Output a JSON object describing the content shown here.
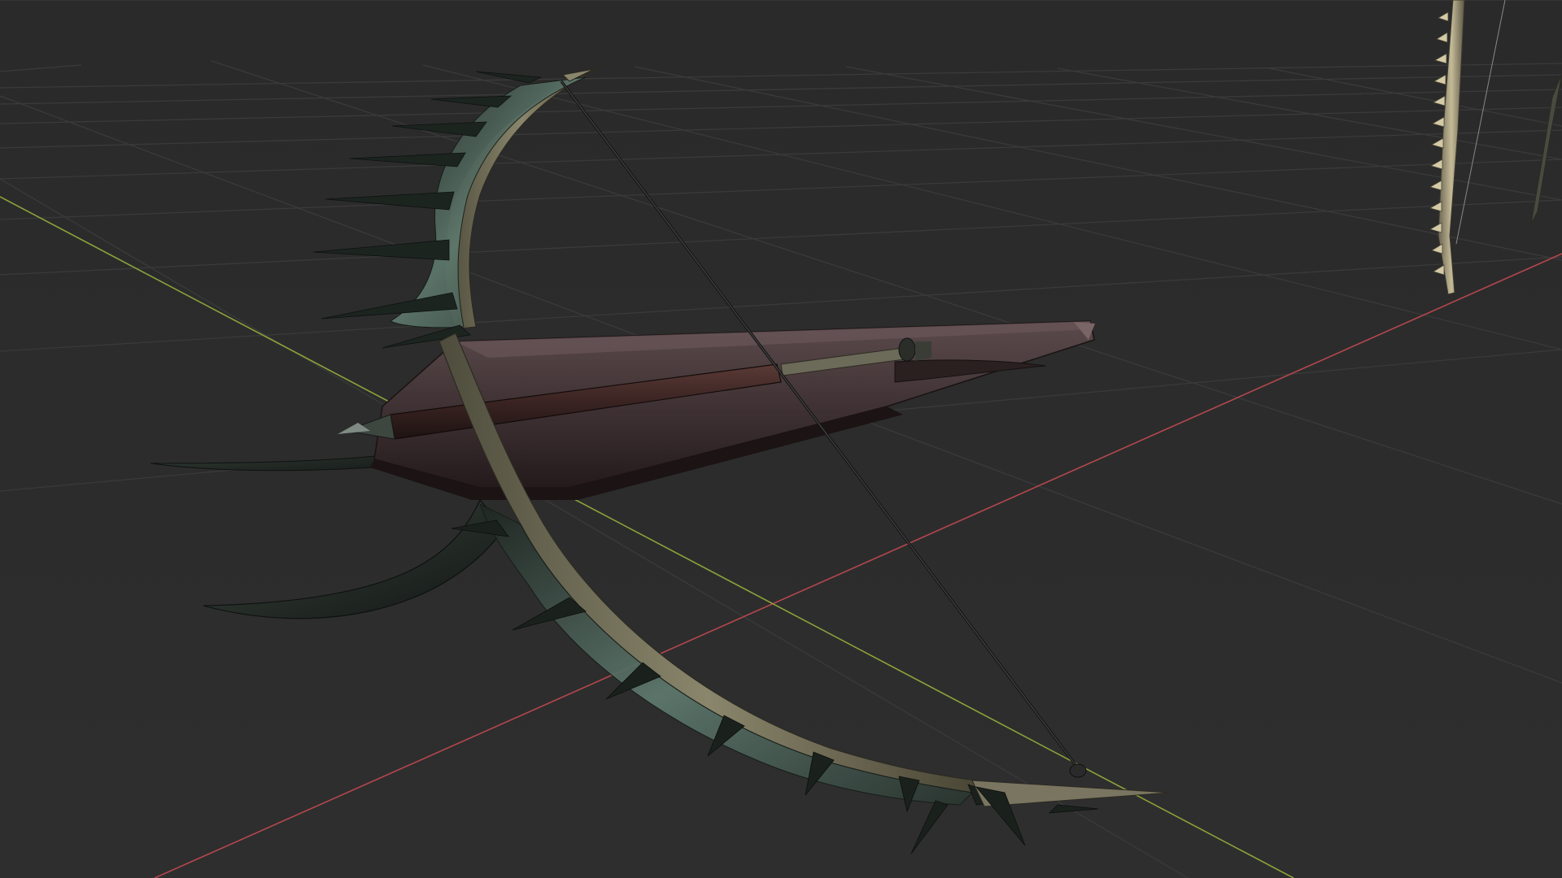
{
  "viewport": {
    "background": "#2b2b2b",
    "grid_color": "#3a3a3a",
    "axes": {
      "x_color": "#c0545a",
      "y_color": "#8aa23a"
    }
  },
  "scene": {
    "main_object": "crossbow",
    "secondary_object": "spiked-bow-limb",
    "colors": {
      "limb_dark": "#1c2420",
      "limb_teal": "#5f7a6f",
      "limb_bark": "#7d7a64",
      "stock": "#3a2c2c",
      "stock_light": "#5b4a4c",
      "bolt": "#3a2422",
      "string": "#1a1a1a",
      "spike_bone": "#b9b08e"
    }
  }
}
